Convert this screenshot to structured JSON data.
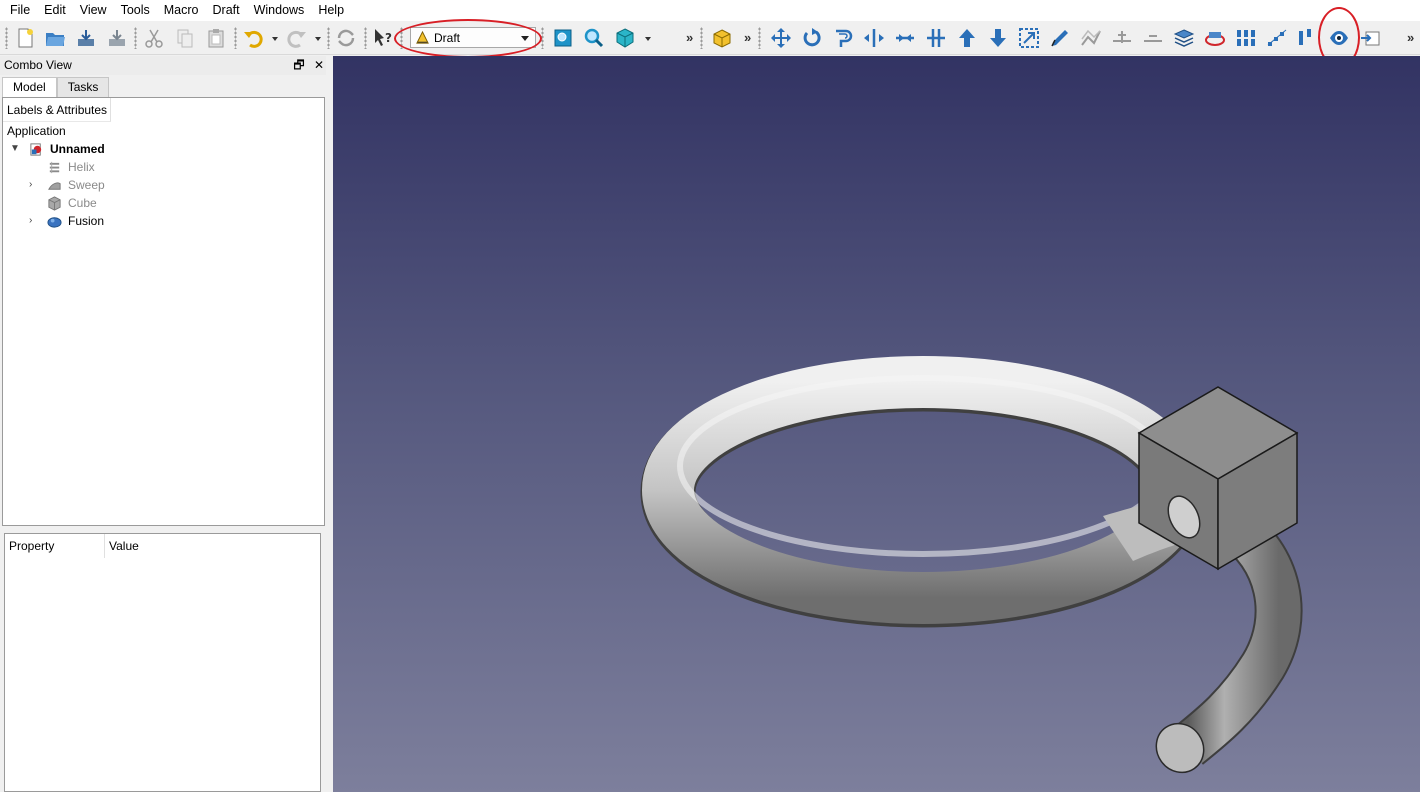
{
  "menu": [
    "File",
    "Edit",
    "View",
    "Tools",
    "Macro",
    "Draft",
    "Windows",
    "Help"
  ],
  "toolbar": {
    "workbench_value": "Draft",
    "more_label": "»"
  },
  "combo": {
    "title": "Combo View",
    "restore_glyph": "🗗",
    "close_glyph": "✕",
    "tabs": [
      "Model",
      "Tasks"
    ],
    "tree_header": "Labels & Attributes",
    "application_label": "Application",
    "document": "Unnamed",
    "items": [
      {
        "label": "Helix",
        "icon": "helix-icon",
        "expandable": false,
        "dim": true
      },
      {
        "label": "Sweep",
        "icon": "sweep-icon",
        "expandable": true,
        "dim": true
      },
      {
        "label": "Cube",
        "icon": "cube-icon",
        "expandable": false,
        "dim": true
      },
      {
        "label": "Fusion",
        "icon": "fusion-icon",
        "expandable": true,
        "dim": false
      }
    ]
  },
  "properties": {
    "col_property": "Property",
    "col_value": "Value"
  },
  "colors": {
    "viewport_top": "#323363",
    "viewport_bottom": "#7d7f9c",
    "highlight_circle": "#d81f26"
  }
}
